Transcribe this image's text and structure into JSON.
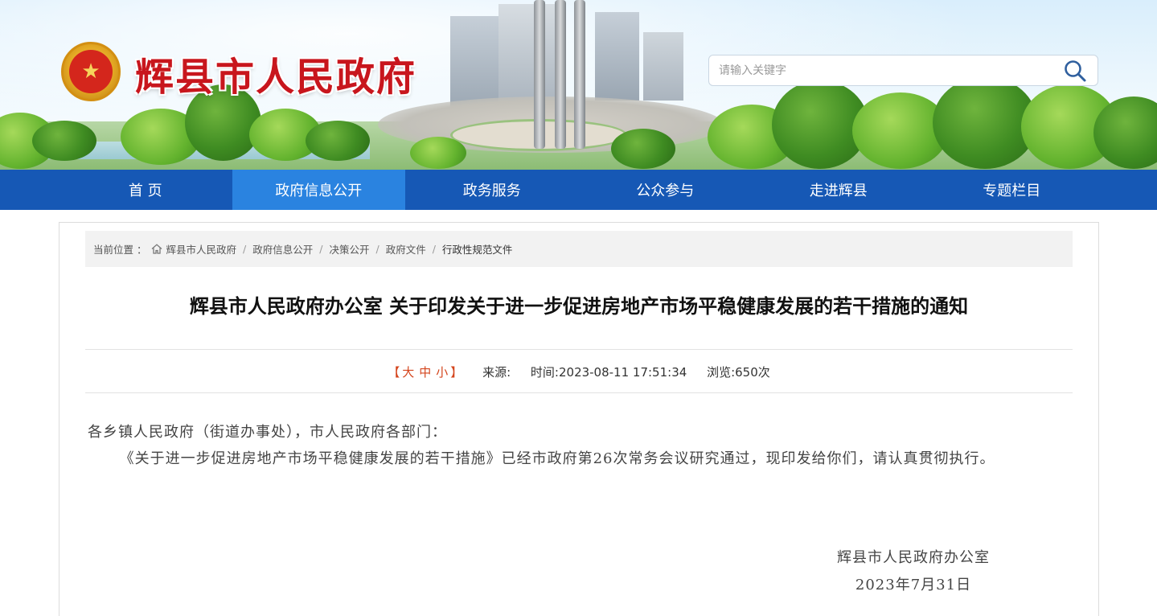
{
  "header": {
    "site_title": "辉县市人民政府",
    "emblem_glyph": "★",
    "search": {
      "placeholder": "请输入关键字",
      "icon": "search-icon"
    }
  },
  "nav": {
    "items": [
      {
        "label": "首 页",
        "active": false
      },
      {
        "label": "政府信息公开",
        "active": true
      },
      {
        "label": "政务服务",
        "active": false
      },
      {
        "label": "公众参与",
        "active": false
      },
      {
        "label": "走进辉县",
        "active": false
      },
      {
        "label": "专题栏目",
        "active": false
      }
    ]
  },
  "breadcrumb": {
    "prefix": "当前位置 ：",
    "items": [
      "辉县市人民政府",
      "政府信息公开",
      "决策公开",
      "政府文件",
      "行政性规范文件"
    ],
    "separator": "/"
  },
  "article": {
    "title": "辉县市人民政府办公室 关于印发关于进一步促进房地产市场平稳健康发展的若干措施的通知",
    "meta": {
      "font_size_open": "【",
      "font_size_large": "大",
      "font_size_medium": "中",
      "font_size_small": "小",
      "font_size_close": "】",
      "source": "来源:",
      "time": "时间:2023-08-11 17:51:34",
      "views": "浏览:650次"
    },
    "salutation": "各乡镇人民政府（街道办事处），市人民政府各部门：",
    "paragraph": "《关于进一步促进房地产市场平稳健康发展的若干措施》已经市政府第26次常务会议研究通过，现印发给你们，请认真贯彻执行。",
    "signature_org": "辉县市人民政府办公室",
    "signature_date": "2023年7月31日"
  },
  "colors": {
    "nav_bg": "#1658b5",
    "nav_active": "#2a83e0",
    "title_red": "#c8161d",
    "font_ctl": "#d4451d"
  }
}
